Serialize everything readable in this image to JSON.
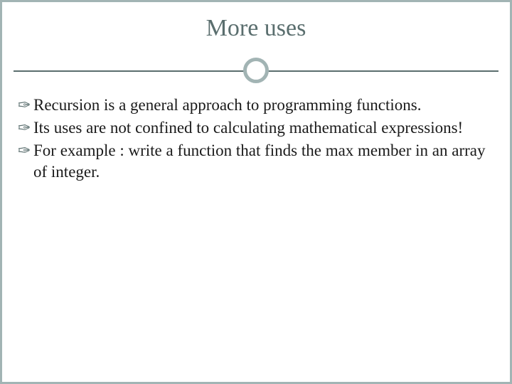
{
  "slide": {
    "title": "More uses",
    "bullets": [
      "Recursion is a general approach to programming functions.",
      "Its uses are not confined to calculating mathematical expressions!",
      "For example : write a function that  finds the max member in an array of integer."
    ],
    "bullet_glyph": "✑"
  },
  "theme": {
    "border_color": "#a2b4b4",
    "accent_color": "#5a6e6e"
  }
}
